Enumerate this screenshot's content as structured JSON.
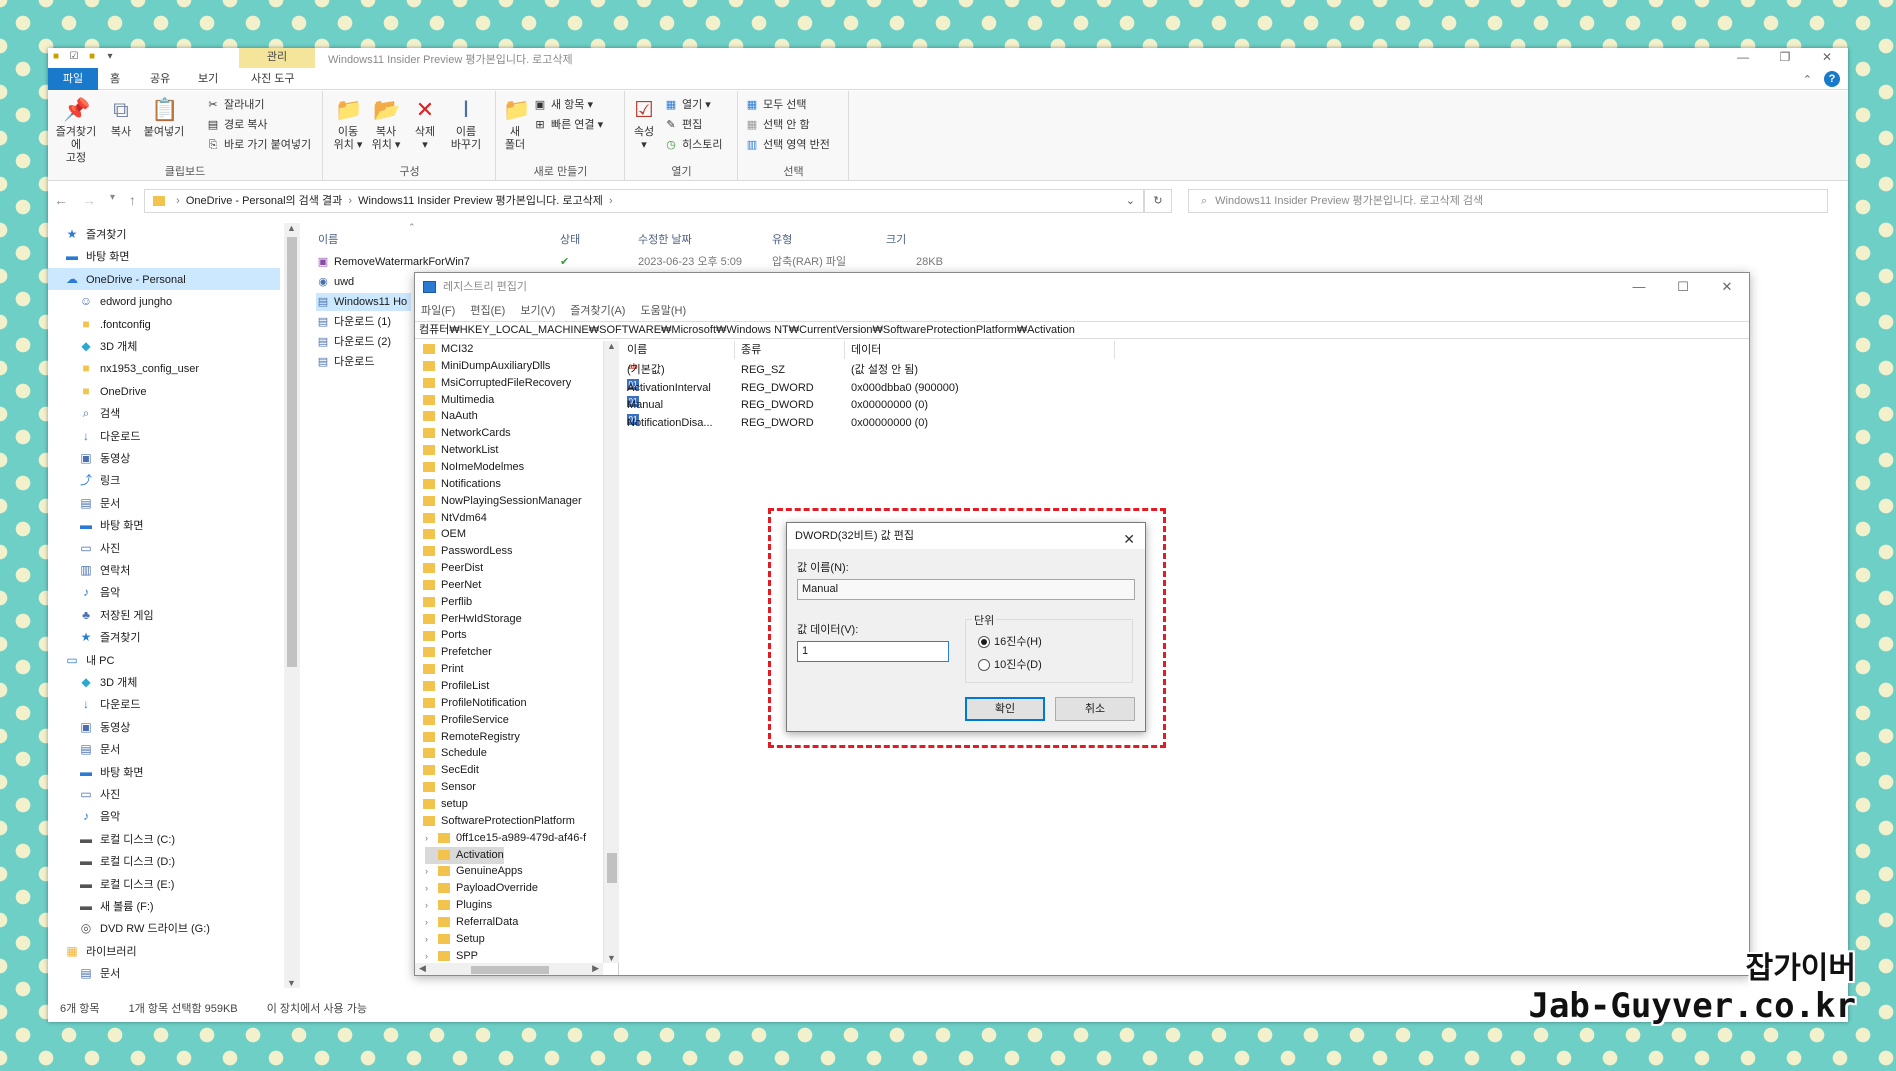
{
  "explorer": {
    "window_title": "Windows11 Insider Preview 평가본입니다. 로고삭제",
    "context_tab": "관리",
    "tabs": [
      "파일",
      "홈",
      "공유",
      "보기",
      "사진 도구"
    ],
    "ribbon": {
      "clipboard": {
        "label": "클립보드",
        "pin": "즐겨찾기에\n고정",
        "copy": "복사",
        "paste": "붙여넣기",
        "cut": "잘라내기",
        "copy_path": "경로 복사",
        "paste_shortcut": "바로 가기 붙여넣기"
      },
      "organize": {
        "label": "구성",
        "move": "이동\n위치 ▾",
        "copyto": "복사\n위치 ▾",
        "delete": "삭제\n▾",
        "rename": "이름\n바꾸기"
      },
      "new": {
        "label": "새로 만들기",
        "new_folder": "새\n폴더",
        "new_item": "새 항목 ▾",
        "easy_access": "빠른 연결 ▾"
      },
      "open": {
        "label": "열기",
        "properties": "속성\n▾",
        "open": "열기 ▾",
        "edit": "편집",
        "history": "히스토리"
      },
      "select": {
        "label": "선택",
        "select_all": "모두 선택",
        "select_none": "선택 안 함",
        "invert": "선택 영역 반전"
      }
    },
    "address": {
      "parts": [
        "OneDrive - Personal의 검색 결과",
        "Windows11 Insider Preview 평가본입니다. 로고삭제"
      ],
      "search_placeholder": "Windows11 Insider Preview 평가본입니다. 로고삭제 검색"
    },
    "nav_items": [
      {
        "label": "즐겨찾기",
        "icon": "star-icon"
      },
      {
        "label": "바탕 화면",
        "icon": "desktop-icon"
      },
      {
        "label": "OneDrive - Personal",
        "icon": "cloud-icon"
      },
      {
        "label": "edword jungho",
        "icon": "user-icon"
      },
      {
        "label": ".fontconfig",
        "icon": "folder-icon"
      },
      {
        "label": "3D 개체",
        "icon": "cube-icon"
      },
      {
        "label": "nx1953_config_user",
        "icon": "folder-icon"
      },
      {
        "label": "OneDrive",
        "icon": "folder-icon"
      },
      {
        "label": "검색",
        "icon": "search-icon"
      },
      {
        "label": "다운로드",
        "icon": "download-icon"
      },
      {
        "label": "동영상",
        "icon": "video-icon"
      },
      {
        "label": "링크",
        "icon": "link-icon"
      },
      {
        "label": "문서",
        "icon": "document-icon"
      },
      {
        "label": "바탕 화면",
        "icon": "desktop-icon"
      },
      {
        "label": "사진",
        "icon": "picture-icon"
      },
      {
        "label": "연락처",
        "icon": "contacts-icon"
      },
      {
        "label": "음악",
        "icon": "music-icon"
      },
      {
        "label": "저장된 게임",
        "icon": "game-icon"
      },
      {
        "label": "즐겨찾기",
        "icon": "star-icon"
      },
      {
        "label": "내 PC",
        "icon": "pc-icon"
      },
      {
        "label": "3D 개체",
        "icon": "cube-icon"
      },
      {
        "label": "다운로드",
        "icon": "download-icon"
      },
      {
        "label": "동영상",
        "icon": "video-icon"
      },
      {
        "label": "문서",
        "icon": "document-icon"
      },
      {
        "label": "바탕 화면",
        "icon": "desktop-icon"
      },
      {
        "label": "사진",
        "icon": "picture-icon"
      },
      {
        "label": "음악",
        "icon": "music-icon"
      },
      {
        "label": "로컬 디스크 (C:)",
        "icon": "drive-icon"
      },
      {
        "label": "로컬 디스크 (D:)",
        "icon": "drive-icon"
      },
      {
        "label": "로컬 디스크 (E:)",
        "icon": "drive-icon"
      },
      {
        "label": "새 볼륨 (F:)",
        "icon": "drive-icon"
      },
      {
        "label": "DVD RW 드라이브 (G:)",
        "icon": "dvd-icon"
      },
      {
        "label": "라이브러리",
        "icon": "library-icon"
      },
      {
        "label": "문서",
        "icon": "document-icon"
      }
    ],
    "columns": [
      "이름",
      "상태",
      "수정한 날짜",
      "유형",
      "크기"
    ],
    "files": [
      {
        "name": "RemoveWatermarkForWin7",
        "status": "✔",
        "date": "2023-06-23 오후 5:09",
        "type": "압축(RAR) 파일",
        "size": "28KB"
      },
      {
        "name": "uwd"
      },
      {
        "name": "Windows11 Ho"
      },
      {
        "name": "다운로드 (1)"
      },
      {
        "name": "다운로드 (2)"
      },
      {
        "name": "다운로드"
      }
    ],
    "status": [
      "6개 항목",
      "1개 항목 선택함 959KB",
      "이 장치에서 사용 가능"
    ]
  },
  "regedit": {
    "title": "레지스트리 편집기",
    "menu": [
      "파일(F)",
      "편집(E)",
      "보기(V)",
      "즐겨찾기(A)",
      "도움말(H)"
    ],
    "path": "컴퓨터₩HKEY_LOCAL_MACHINE₩SOFTWARE₩Microsoft₩Windows NT₩CurrentVersion₩SoftwareProtectionPlatform₩Activation",
    "tree": [
      "MCI32",
      "MiniDumpAuxiliaryDlls",
      "MsiCorruptedFileRecovery",
      "Multimedia",
      "NaAuth",
      "NetworkCards",
      "NetworkList",
      "NoImeModelmes",
      "Notifications",
      "NowPlayingSessionManager",
      "NtVdm64",
      "OEM",
      "PasswordLess",
      "PeerDist",
      "PeerNet",
      "Perflib",
      "PerHwIdStorage",
      "Ports",
      "Prefetcher",
      "Print",
      "ProfileList",
      "ProfileNotification",
      "ProfileService",
      "RemoteRegistry",
      "Schedule",
      "SecEdit",
      "Sensor",
      "setup",
      "SoftwareProtectionPlatform"
    ],
    "subtree": [
      "0ff1ce15-a989-479d-af46-f",
      "Activation",
      "GenuineApps",
      "PayloadOverride",
      "Plugins",
      "ReferralData",
      "Setup",
      "SPP"
    ],
    "columns": [
      "이름",
      "종류",
      "데이터"
    ],
    "values": [
      {
        "name": "(기본값)",
        "type": "REG_SZ",
        "data": "(값 설정 안 됨)",
        "icon": "ab"
      },
      {
        "name": "ActivationInterval",
        "type": "REG_DWORD",
        "data": "0x000dbba0 (900000)",
        "icon": "dw"
      },
      {
        "name": "Manual",
        "type": "REG_DWORD",
        "data": "0x00000000 (0)",
        "icon": "dw"
      },
      {
        "name": "NotificationDisa...",
        "type": "REG_DWORD",
        "data": "0x00000000 (0)",
        "icon": "dw"
      }
    ]
  },
  "dialog": {
    "title": "DWORD(32비트) 값 편집",
    "name_label": "값 이름(N):",
    "name_value": "Manual",
    "data_label": "값 데이터(V):",
    "data_value": "1",
    "base_label": "단위",
    "hex_label": "16진수(H)",
    "dec_label": "10진수(D)",
    "ok": "확인",
    "cancel": "취소",
    "highlight_color": "#e31b23"
  },
  "watermark": {
    "line1": "잡가이버",
    "line2": "Jab-Guyver.co.kr"
  }
}
